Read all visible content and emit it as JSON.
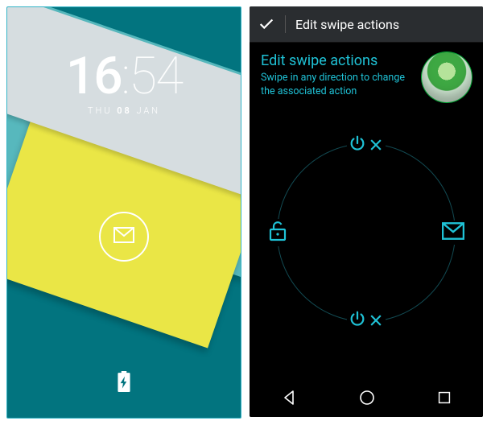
{
  "left": {
    "clock": {
      "hours": "16",
      "sep": ":",
      "minutes": "54",
      "weekday": "THU",
      "day": "08",
      "month": "JAN"
    },
    "center_action": "gmail-icon",
    "battery_charging": true
  },
  "right": {
    "actionbar": {
      "confirm": "done",
      "title": "Edit swipe actions"
    },
    "header": {
      "title": "Edit swipe actions",
      "subtitle": "Swipe in any direction to change the associated action"
    },
    "avatar": "android-figurine",
    "slots": {
      "top": {
        "action": "power-off",
        "removable": true
      },
      "bottom": {
        "action": "power-off",
        "removable": true
      },
      "left": {
        "action": "unlock",
        "removable": false
      },
      "right": {
        "action": "gmail",
        "removable": false
      }
    },
    "nav": [
      "back",
      "home",
      "recent"
    ]
  },
  "colors": {
    "accent": "#1fc2d6"
  }
}
